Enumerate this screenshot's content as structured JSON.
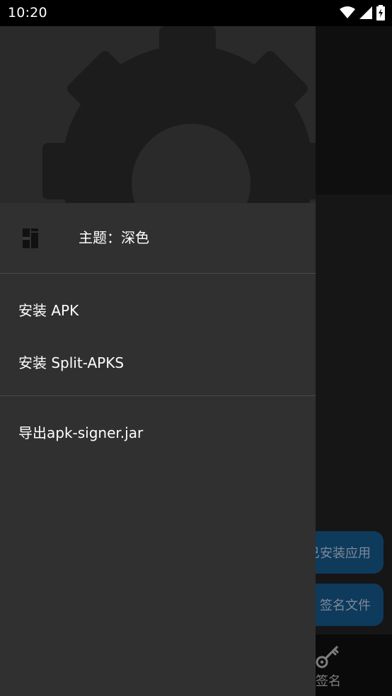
{
  "status_bar": {
    "time": "10:20",
    "icons": [
      "wifi-icon",
      "signal-icon",
      "battery-charging-icon"
    ]
  },
  "drawer": {
    "header_icon": "gear-icon",
    "theme_label": "主题：深色",
    "theme_icon": "theme-icon",
    "menu": [
      {
        "label": "安装 APK"
      },
      {
        "label": "安装 Split-APKS"
      },
      {
        "label": "导出apk-signer.jar"
      }
    ]
  },
  "background_app": {
    "button_installed_apps": "已安装应用",
    "button_sign_file": "签名文件",
    "nav_label": "签名",
    "nav_icon": "key-icon"
  },
  "colors": {
    "drawer_bg": "#303030",
    "drawer_header_bg": "#2a2a2a",
    "accent_button": "#0e3a5c",
    "status_bar": "#000000"
  }
}
